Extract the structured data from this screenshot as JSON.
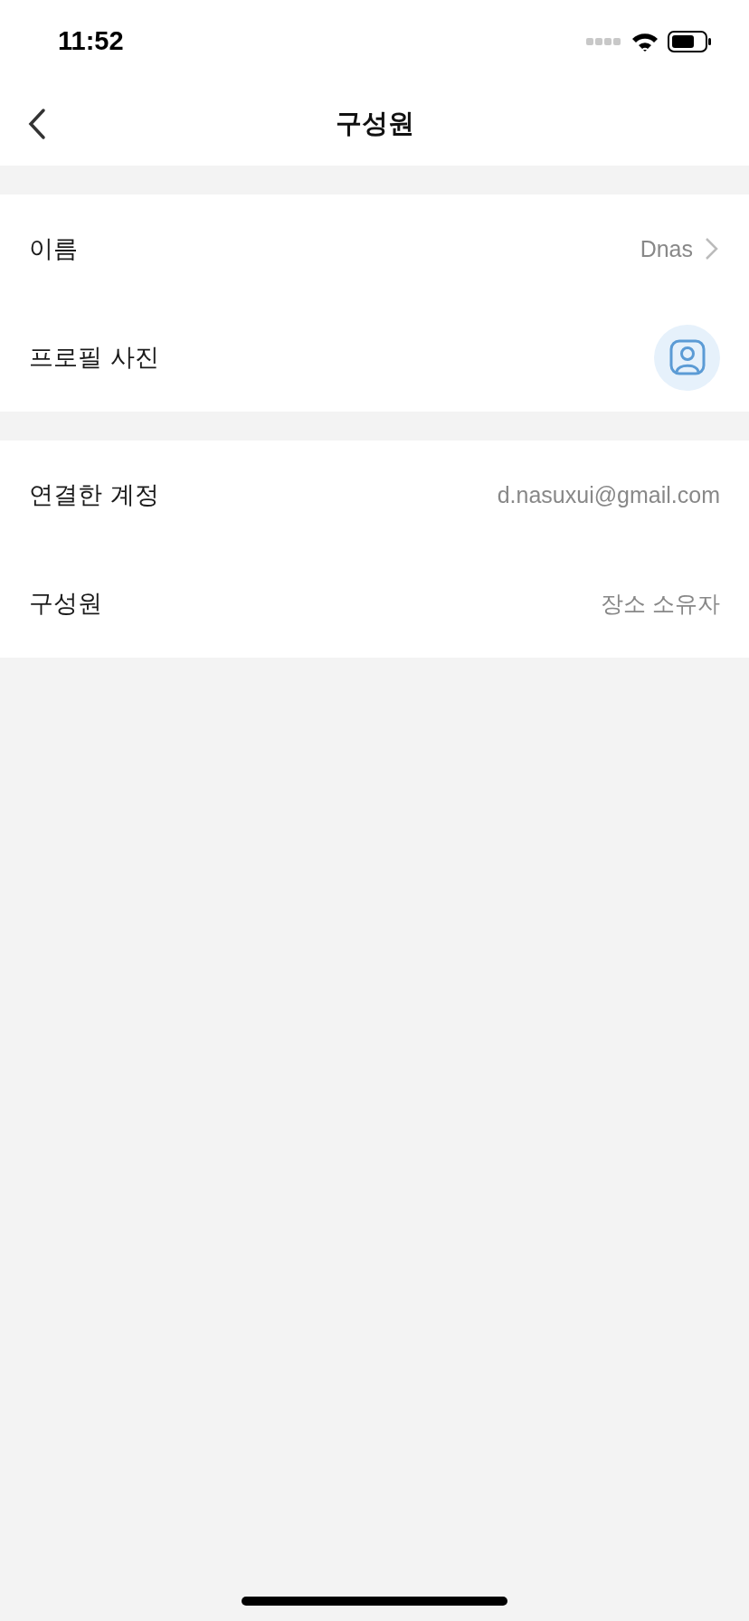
{
  "status_bar": {
    "time": "11:52"
  },
  "nav": {
    "title": "구성원"
  },
  "sections": [
    {
      "rows": [
        {
          "kind": "text",
          "label": "이름",
          "value": "Dnas",
          "chevron": true
        },
        {
          "kind": "avatar",
          "label": "프로필 사진",
          "chevron": false
        }
      ]
    },
    {
      "rows": [
        {
          "kind": "text",
          "label": "연결한 계정",
          "value": "d.nasuxui@gmail.com",
          "chevron": false
        },
        {
          "kind": "text",
          "label": "구성원",
          "value": "장소 소유자",
          "chevron": false
        }
      ]
    }
  ]
}
